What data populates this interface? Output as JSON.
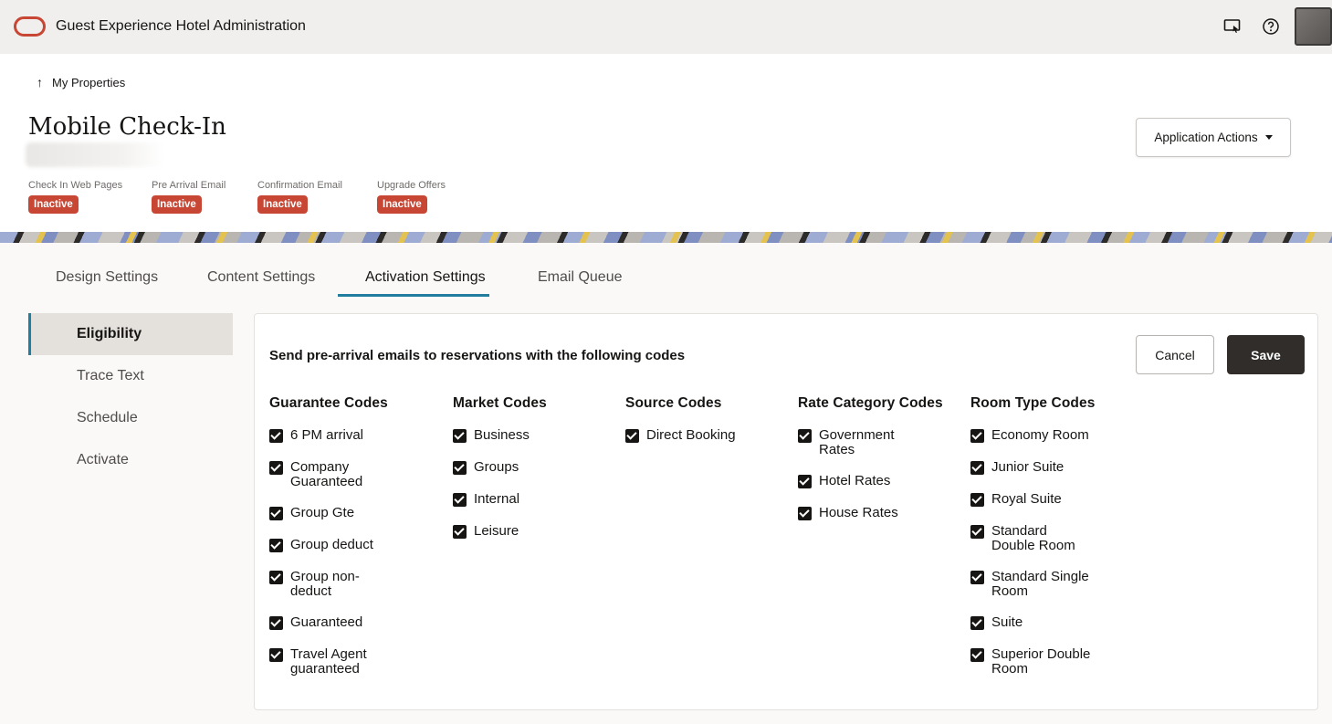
{
  "header": {
    "app_title": "Guest Experience Hotel Administration",
    "icons": [
      "oracle-logo-icon",
      "screen-share-icon",
      "help-icon",
      "user-avatar"
    ]
  },
  "page": {
    "back_label": "My Properties",
    "title": "Mobile Check-In",
    "statuses": [
      {
        "label": "Check In Web Pages",
        "value": "Inactive"
      },
      {
        "label": "Pre Arrival Email",
        "value": "Inactive"
      },
      {
        "label": "Confirmation Email",
        "value": "Inactive"
      },
      {
        "label": "Upgrade Offers",
        "value": "Inactive"
      }
    ],
    "actions_label": "Application Actions"
  },
  "tabs": [
    {
      "label": "Design Settings"
    },
    {
      "label": "Content Settings"
    },
    {
      "label": "Activation Settings",
      "active": true
    },
    {
      "label": "Email Queue"
    }
  ],
  "leftnav": [
    {
      "label": "Eligibility",
      "active": true
    },
    {
      "label": "Trace Text"
    },
    {
      "label": "Schedule"
    },
    {
      "label": "Activate"
    }
  ],
  "card": {
    "title": "Send pre-arrival emails to reservations with the following codes",
    "cancel_label": "Cancel",
    "save_label": "Save",
    "columns": [
      {
        "heading": "Guarantee Codes",
        "items": [
          {
            "label": "6 PM arrival",
            "checked": true
          },
          {
            "label": "Company Guaranteed",
            "checked": true
          },
          {
            "label": "Group Gte",
            "checked": true
          },
          {
            "label": "Group deduct",
            "checked": true
          },
          {
            "label": "Group non-deduct",
            "checked": true
          },
          {
            "label": "Guaranteed",
            "checked": true
          },
          {
            "label": "Travel Agent guaranteed",
            "checked": true
          }
        ]
      },
      {
        "heading": "Market Codes",
        "items": [
          {
            "label": "Business",
            "checked": true
          },
          {
            "label": "Groups",
            "checked": true
          },
          {
            "label": "Internal",
            "checked": true
          },
          {
            "label": "Leisure",
            "checked": true
          }
        ]
      },
      {
        "heading": "Source Codes",
        "items": [
          {
            "label": "Direct Booking",
            "checked": true
          }
        ]
      },
      {
        "heading": "Rate Category Codes",
        "items": [
          {
            "label": "Government Rates",
            "checked": true
          },
          {
            "label": "Hotel Rates",
            "checked": true
          },
          {
            "label": "House Rates",
            "checked": true
          }
        ]
      },
      {
        "heading": "Room Type Codes",
        "items": [
          {
            "label": "Economy Room",
            "checked": true
          },
          {
            "label": "Junior Suite",
            "checked": true
          },
          {
            "label": "Royal Suite",
            "checked": true
          },
          {
            "label": "Standard Double Room",
            "checked": true
          },
          {
            "label": "Standard Single Room",
            "checked": true
          },
          {
            "label": "Suite",
            "checked": true
          },
          {
            "label": "Superior Double Room",
            "checked": true
          }
        ]
      }
    ]
  },
  "colors": {
    "accent": "#227e9e",
    "badge_red": "#c74634",
    "save_button": "#312d2a"
  }
}
